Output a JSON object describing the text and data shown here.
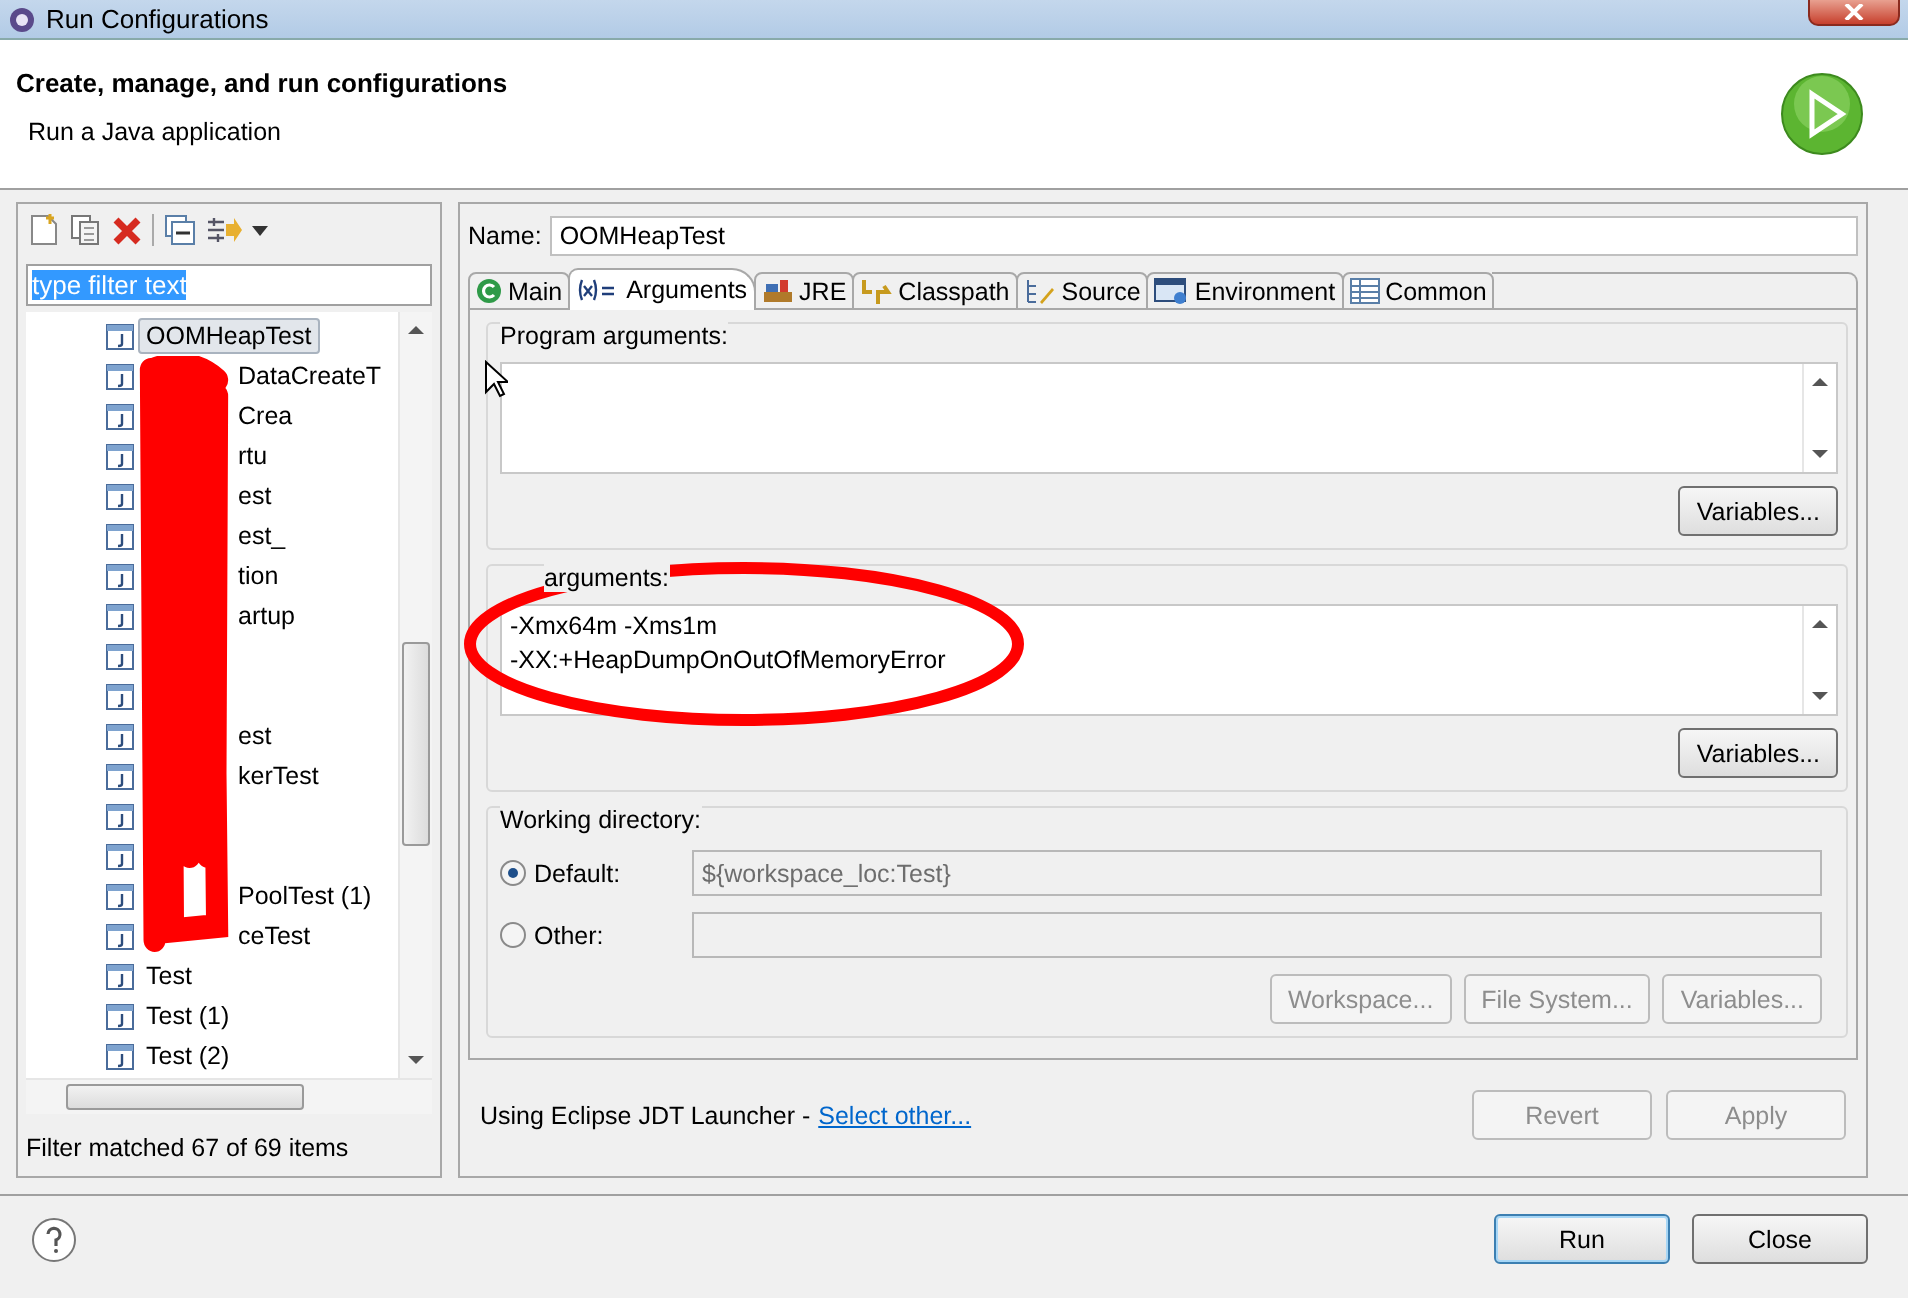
{
  "window": {
    "title": "Run Configurations"
  },
  "header": {
    "title": "Create, manage, and run configurations",
    "subtitle": "Run a Java application"
  },
  "sidebar": {
    "filter": {
      "value": "type filter text",
      "selected": true
    },
    "items": [
      {
        "label": "OOMHeapTest",
        "selected": true
      },
      {
        "label": "DataCreateT",
        "selected": false,
        "partial": true
      },
      {
        "label": "Crea",
        "selected": false,
        "partial": true
      },
      {
        "label": "rtu",
        "selected": false,
        "partial": true
      },
      {
        "label": "est",
        "selected": false,
        "partial": true
      },
      {
        "label": "est_",
        "selected": false,
        "partial": true
      },
      {
        "label": "tion",
        "selected": false,
        "partial": true
      },
      {
        "label": "artup",
        "selected": false,
        "partial": true
      },
      {
        "selected": false
      },
      {
        "selected": false
      },
      {
        "label": "est",
        "selected": false,
        "partial": true
      },
      {
        "label": "kerTest",
        "selected": false,
        "partial": true
      },
      {
        "selected": false
      },
      {
        "selected": false
      },
      {
        "label": "PoolTest (1)",
        "selected": false,
        "partial": true
      },
      {
        "label": "ceTest",
        "selected": false,
        "partial": true
      },
      {
        "label": "Test",
        "selected": false
      },
      {
        "label": "Test (1)",
        "selected": false
      },
      {
        "label": "Test (2)",
        "selected": false
      }
    ],
    "status": "Filter matched 67 of 69 items"
  },
  "name": {
    "label": "Name:",
    "value": "OOMHeapTest"
  },
  "tabs": [
    {
      "label": "Main",
      "kind": "main",
      "selected": false
    },
    {
      "label": "Arguments",
      "kind": "arguments",
      "selected": true
    },
    {
      "label": "JRE",
      "kind": "jre",
      "selected": false
    },
    {
      "label": "Classpath",
      "kind": "classpath",
      "selected": false
    },
    {
      "label": "Source",
      "kind": "source",
      "selected": false
    },
    {
      "label": "Environment",
      "kind": "environment",
      "selected": false
    },
    {
      "label": "Common",
      "kind": "common",
      "selected": false
    }
  ],
  "program_arguments": {
    "label": "Program arguments:",
    "button": "Variables..."
  },
  "vm_arguments": {
    "label": "arguments:",
    "lines": [
      "-Xmx64m -Xms1m",
      "-XX:+HeapDumpOnOutOfMemoryError"
    ],
    "button": "Variables..."
  },
  "working_directory": {
    "label": "Working directory:",
    "options": [
      {
        "label": "Default:",
        "selected": true,
        "value": "${workspace_loc:Test}"
      },
      {
        "label": "Other:",
        "selected": false
      }
    ],
    "buttons": [
      {
        "label": "Workspace...",
        "disabled": true
      },
      {
        "label": "File System...",
        "disabled": true
      },
      {
        "label": "Variables...",
        "disabled": true
      }
    ]
  },
  "launcher": {
    "text": "Using Eclipse JDT Launcher -",
    "link": "Select other..."
  },
  "actions": [
    {
      "label": "Revert",
      "disabled": true
    },
    {
      "label": "Apply",
      "disabled": true
    }
  ],
  "footer_buttons": [
    {
      "label": "Run",
      "default": true
    },
    {
      "label": "Close",
      "default": false
    }
  ]
}
